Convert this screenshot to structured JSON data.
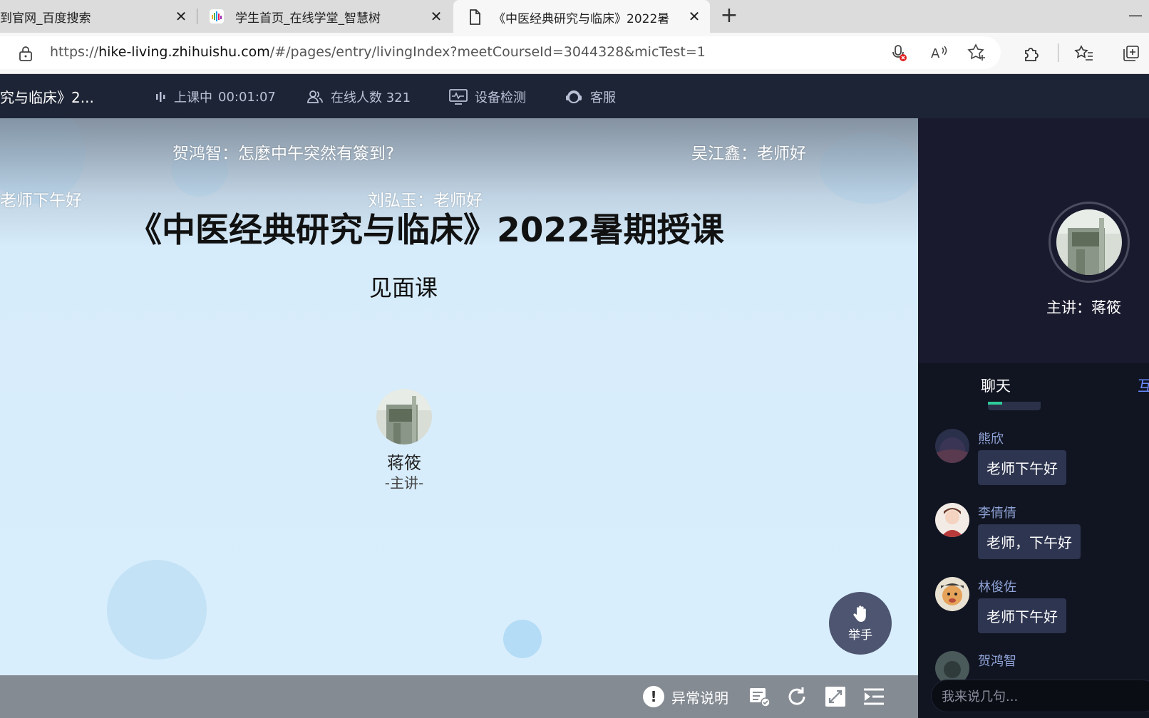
{
  "browser": {
    "tabs": [
      {
        "title": "到官网_百度搜索"
      },
      {
        "title": "学生首页_在线学堂_智慧树"
      },
      {
        "title": "《中医经典研究与临床》2022暑"
      }
    ],
    "url_prefix": "https://",
    "url_host": "hike-living.zhihuishu.com",
    "url_path": "/#/pages/entry/livingIndex?meetCourseId=3044328&micTest=1",
    "close_glyph": "✕",
    "newtab_glyph": "+",
    "minimize_glyph": "—"
  },
  "header": {
    "course_title": "究与临床》2...",
    "status_label": "上课中",
    "elapsed": "00:01:07",
    "online_label": "在线人数 321",
    "device_check": "设备检测",
    "support": "客服"
  },
  "stage": {
    "danmu": [
      {
        "text": "贺鸿智：怎麼中午突然有簽到?"
      },
      {
        "text": "吴江鑫：老师好"
      },
      {
        "text": "老师下午好"
      },
      {
        "text": "刘弘玉：老师好"
      }
    ],
    "slide_title": "《中医经典研究与临床》2022暑期授课",
    "slide_subtitle": "见面课",
    "teacher_name": "蒋筱",
    "teacher_role": "-主讲-",
    "raise_hand": "举手"
  },
  "bottom_bar": {
    "issue_label": "异常说明"
  },
  "side": {
    "host_label": "主讲：蒋筱",
    "tabs": [
      "聊天",
      "互"
    ],
    "messages": [
      {
        "user": "熊欣",
        "text": "老师下午好"
      },
      {
        "user": "李倩倩",
        "text": "老师，下午好"
      },
      {
        "user": "林俊佐",
        "text": "老师下午好"
      },
      {
        "user": "贺鸿智",
        "text": ""
      }
    ],
    "input_placeholder": "我来说几句..."
  },
  "colors": {
    "header_bg": "#1d2435",
    "side_bg": "#1a1a2e",
    "chat_bg": "#111522",
    "bubble_bg": "#2e3550",
    "accent_green": "#2ecc9a"
  }
}
